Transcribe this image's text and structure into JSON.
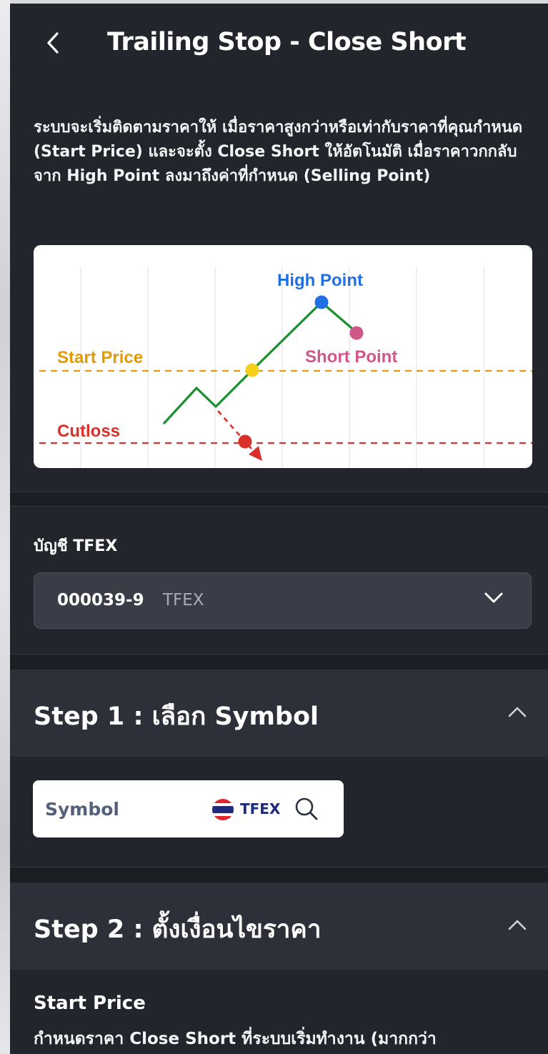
{
  "header": {
    "title": "Trailing Stop - Close Short"
  },
  "intro": {
    "description": "ระบบจะเริ่มติดตามราคาให้ เมื่อราคาสูงกว่าหรือเท่ากับราคาที่คุณกำหนด (Start Price) และจะตั้ง Close Short ให้อัตโนมัติ เมื่อราคาวกกลับจาก High Point ลงมาถึงค่าที่กำหนด (Selling Point)"
  },
  "diagram": {
    "labels": {
      "high_point": "High Point",
      "start_price": "Start Price",
      "short_point": "Short Point",
      "cutloss": "Cutloss"
    },
    "colors": {
      "line": "#1a8f2e",
      "high_point": "#1f6fe5",
      "start_price": "#e39b00",
      "short_point": "#d0578a",
      "cutloss": "#d9302a",
      "start_point_dot": "#f7cf1d"
    }
  },
  "account": {
    "label": "บัญชี TFEX",
    "number": "000039-9",
    "market": "TFEX"
  },
  "step1": {
    "title": "Step 1 : เลือก Symbol",
    "symbol_placeholder": "Symbol",
    "market_tag": "TFEX"
  },
  "step2": {
    "title": "Step 2 : ตั้งเงื่อนไขราคา",
    "start_price_label": "Start Price",
    "start_price_desc": "กำหนดราคา Close Short ที่ระบบเริ่มทำงาน (มากกว่า"
  },
  "icons": {
    "back": "chevron-left-icon",
    "dropdown": "chevron-down-icon",
    "collapse": "chevron-up-icon",
    "search": "search-icon",
    "flag": "thailand-flag-icon"
  }
}
